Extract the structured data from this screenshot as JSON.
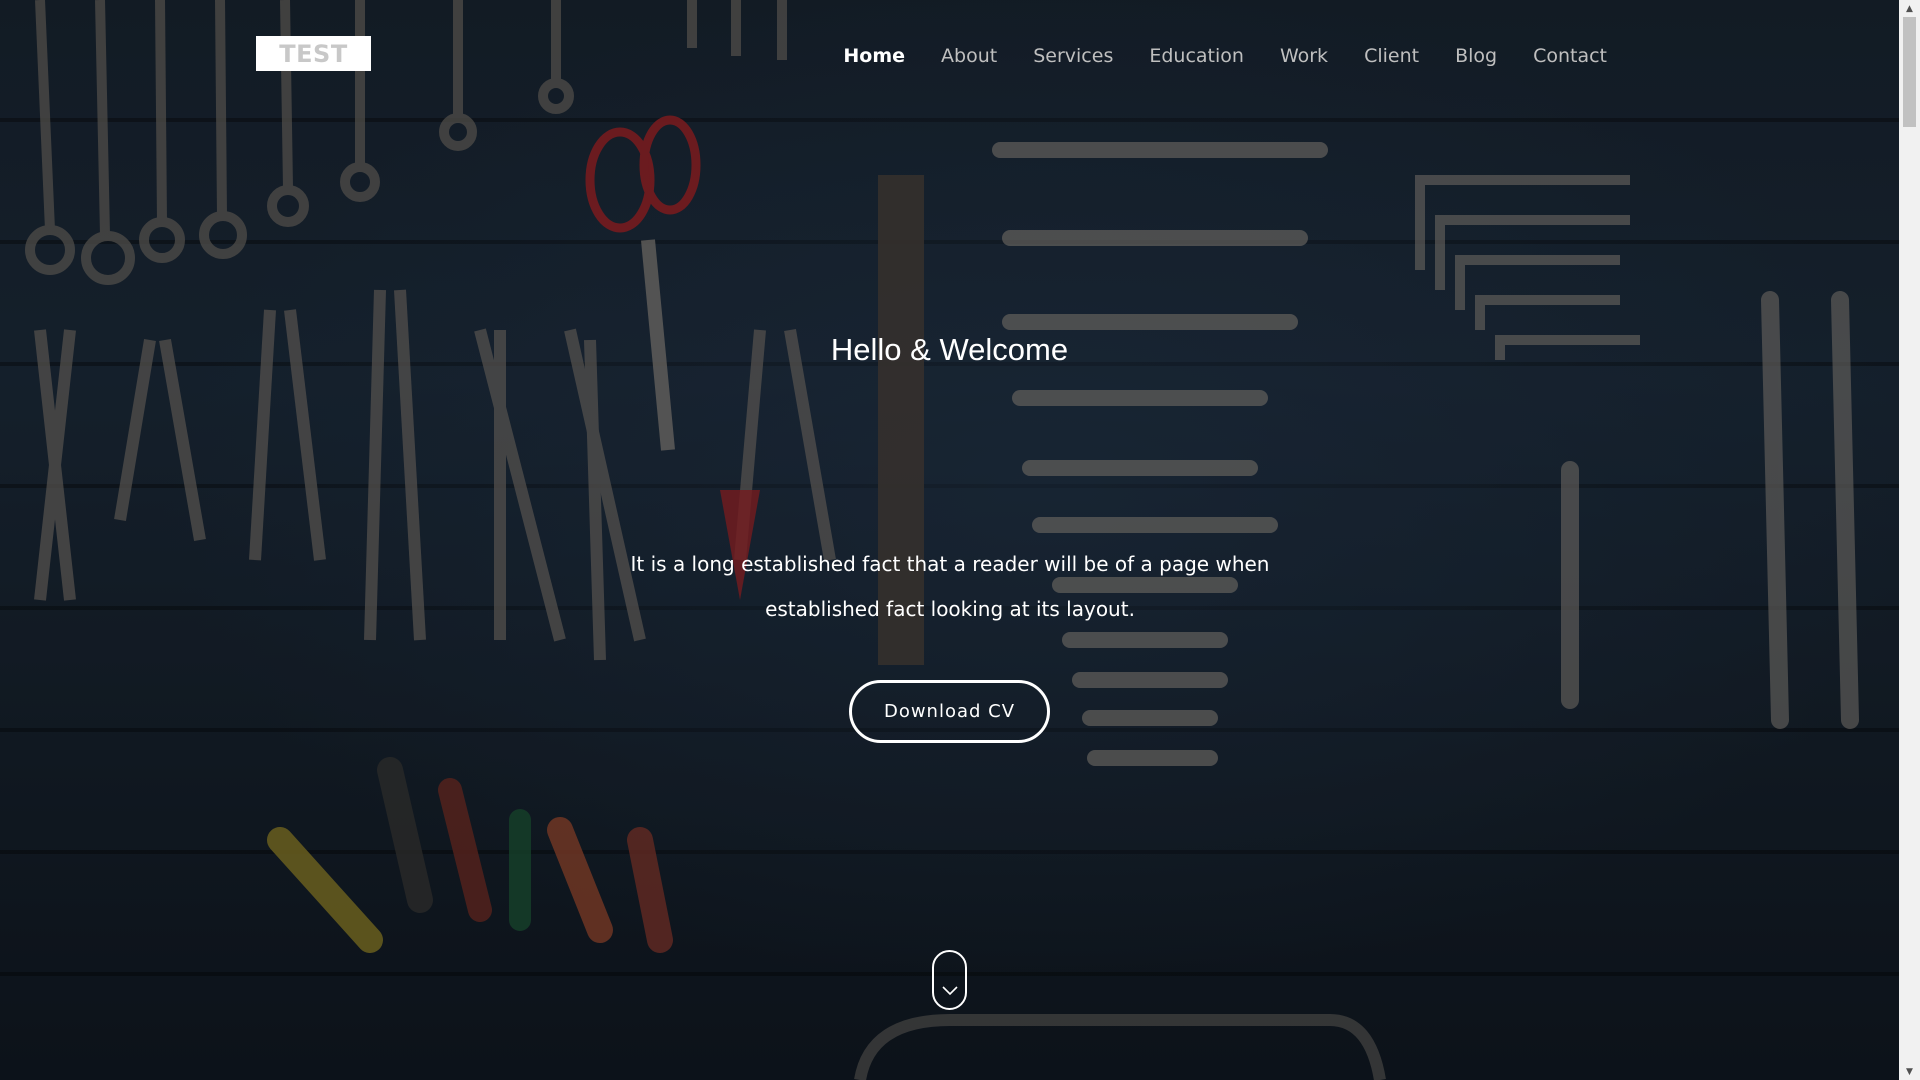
{
  "logo": {
    "text": "TEST"
  },
  "nav": {
    "items": [
      {
        "label": "Home",
        "active": true
      },
      {
        "label": "About"
      },
      {
        "label": "Services"
      },
      {
        "label": "Education"
      },
      {
        "label": "Work"
      },
      {
        "label": "Client"
      },
      {
        "label": "Blog"
      },
      {
        "label": "Contact"
      }
    ]
  },
  "hero": {
    "title": "Hello & Welcome",
    "text_line1": "It is a long established fact that a reader will be of a page when",
    "text_line2": "established fact looking at its layout.",
    "button_label": "Download CV",
    "scroll_icon": "chevron-down-icon"
  },
  "scrollbar": {
    "up_icon": "▲",
    "down_icon": "▼"
  },
  "colors": {
    "background": "#1a2633",
    "accent_red": "#a3262b",
    "text": "#ffffff",
    "nav_text": "#bfbfbf"
  }
}
